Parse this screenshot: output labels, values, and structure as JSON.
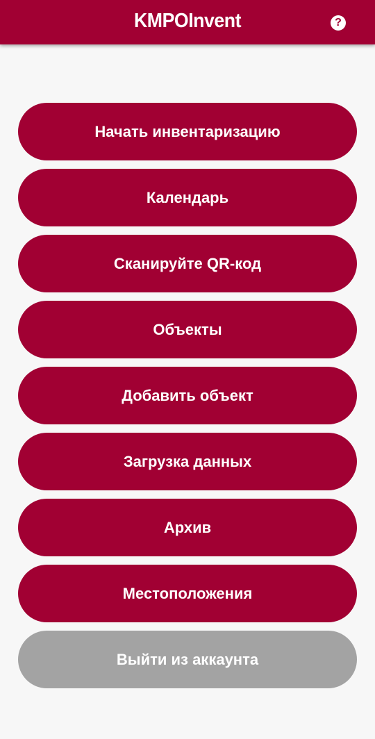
{
  "appbar": {
    "title": "KMPOInvent",
    "help_icon": "help-circle-icon",
    "help_glyph": "?"
  },
  "colors": {
    "primary": "#a10033",
    "background": "#f7f7f7",
    "disabled": "#a3a3a3",
    "text_on_primary": "#ffffff"
  },
  "menu": {
    "start_inventory": "Начать инвентаризацию",
    "calendar": "Календарь",
    "scan_qr": "Сканируйте QR-код",
    "objects": "Объекты",
    "add_object": "Добавить объект",
    "data_upload": "Загрузка данных",
    "archive": "Архив",
    "locations": "Местоположения",
    "logout": "Выйти из аккаунта"
  }
}
